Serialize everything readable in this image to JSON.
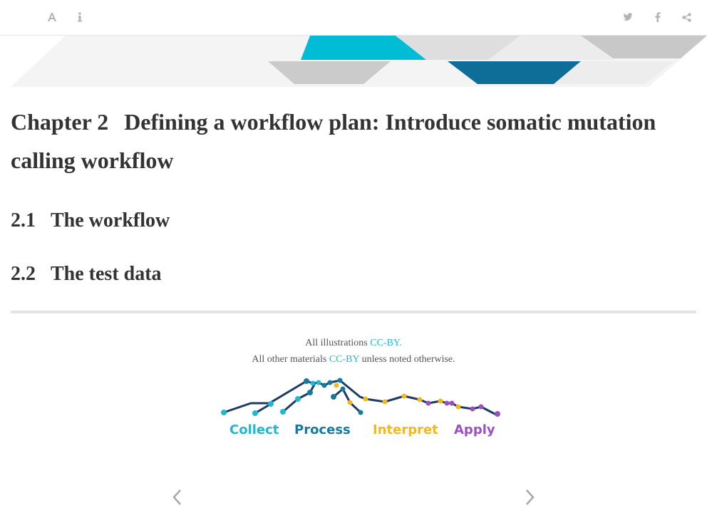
{
  "toolbar": {
    "left_icons": [
      "font-settings-icon",
      "info-icon"
    ],
    "right_icons": [
      "twitter-icon",
      "facebook-icon",
      "share-icon"
    ]
  },
  "chapter": {
    "number": "Chapter 2",
    "title": "Defining a workflow plan: Introduce somatic mutation calling workflow"
  },
  "sections": [
    {
      "number": "2.1",
      "title": "The workflow"
    },
    {
      "number": "2.2",
      "title": "The test data"
    }
  ],
  "footer": {
    "line1_prefix": "All illustrations ",
    "line1_link": "CC-BY.",
    "line2_prefix": "All other materials ",
    "line2_link": "CC-BY",
    "line2_suffix": " unless noted otherwise."
  },
  "logo": {
    "words": [
      "Collect",
      "Process",
      "Interpret",
      "Apply"
    ],
    "colors": {
      "collect": "#1eb8d1",
      "process": "#157a9d",
      "interpret": "#f5b81c",
      "apply": "#9b4fc0",
      "line": "#1f3b63"
    }
  },
  "nav": {
    "prev_icon": "chevron-left-icon",
    "next_icon": "chevron-right-icon"
  },
  "colors": {
    "accent": "#20b8cf",
    "banner_teal": "#00bcd4",
    "banner_blue": "#0f6e97",
    "banner_gray": "#d5d5d5"
  }
}
